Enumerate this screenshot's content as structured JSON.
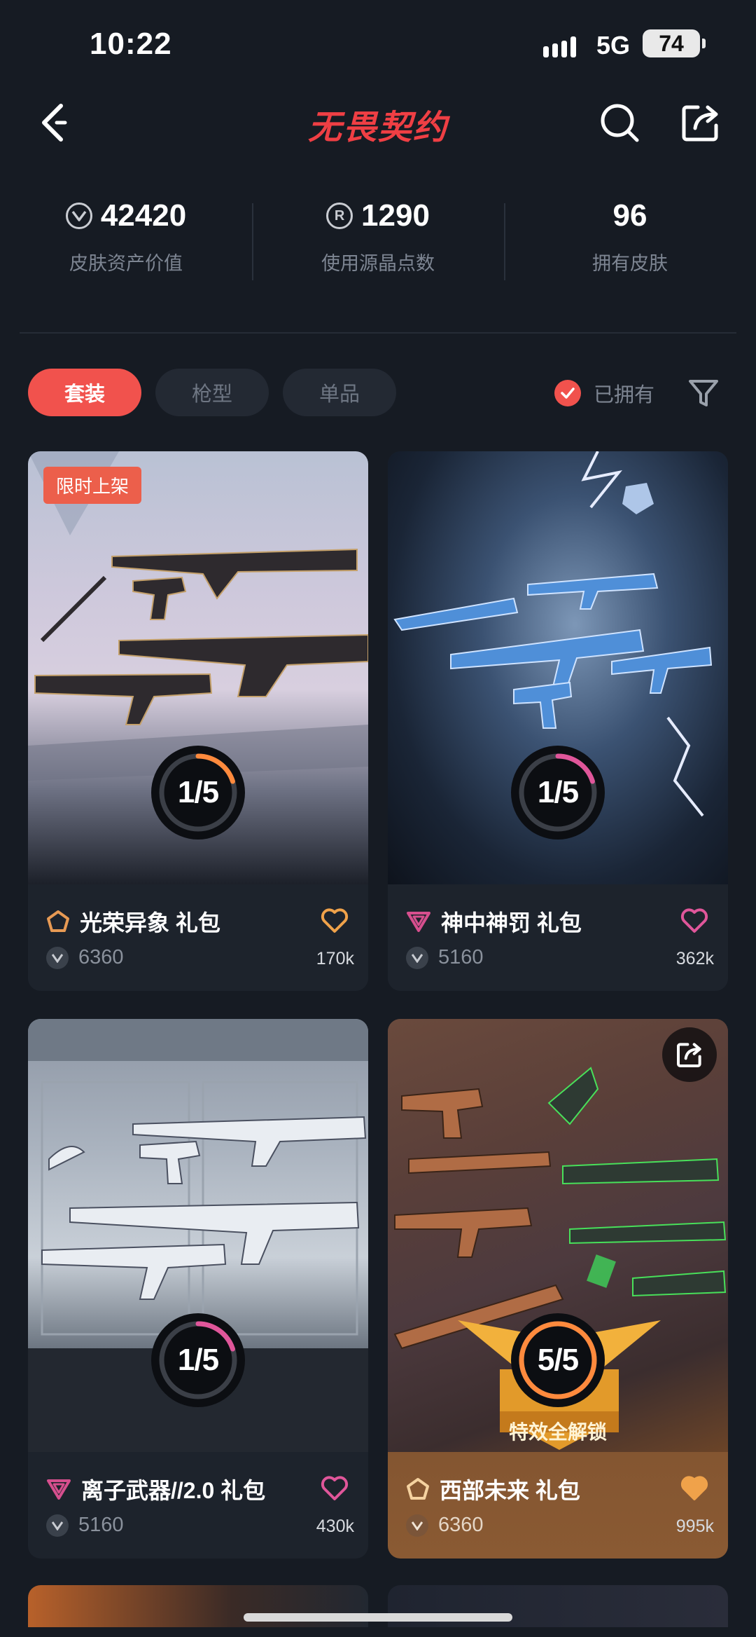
{
  "status": {
    "time": "10:22",
    "network": "5G",
    "battery": "74"
  },
  "header": {
    "title": "无畏契约"
  },
  "stats": [
    {
      "value": "42420",
      "label": "皮肤资产价值",
      "icon": "vp-coin-icon"
    },
    {
      "value": "1290",
      "label": "使用源晶点数",
      "icon": "radianite-icon"
    },
    {
      "value": "96",
      "label": "拥有皮肤"
    }
  ],
  "filters": {
    "tabs": [
      "套装",
      "枪型",
      "单品"
    ],
    "owned_label": "已拥有",
    "owned_checked": true
  },
  "cards": [
    {
      "name": "光荣异象 礼包",
      "price": "6360",
      "likes": "170k",
      "progress": "1/5",
      "progress_fraction": 0.2,
      "badge": "限时上架",
      "tier": "deluxe",
      "liked": false
    },
    {
      "name": "神中神罚 礼包",
      "price": "5160",
      "likes": "362k",
      "progress": "1/5",
      "progress_fraction": 0.2,
      "tier": "premium",
      "liked": false
    },
    {
      "name": "离子武器//2.0 礼包",
      "price": "5160",
      "likes": "430k",
      "progress": "1/5",
      "progress_fraction": 0.2,
      "tier": "premium",
      "liked": false
    },
    {
      "name": "西部未来 礼包",
      "price": "6360",
      "likes": "995k",
      "progress": "5/5",
      "progress_fraction": 1.0,
      "unlock_label": "特效全解锁",
      "tier": "deluxe",
      "liked": true
    }
  ],
  "colors": {
    "accent": "#f1524d",
    "background": "#161b23",
    "card": "#1d232c",
    "heart_pink": "#e0569a",
    "heart_orange": "#f0a24a"
  }
}
